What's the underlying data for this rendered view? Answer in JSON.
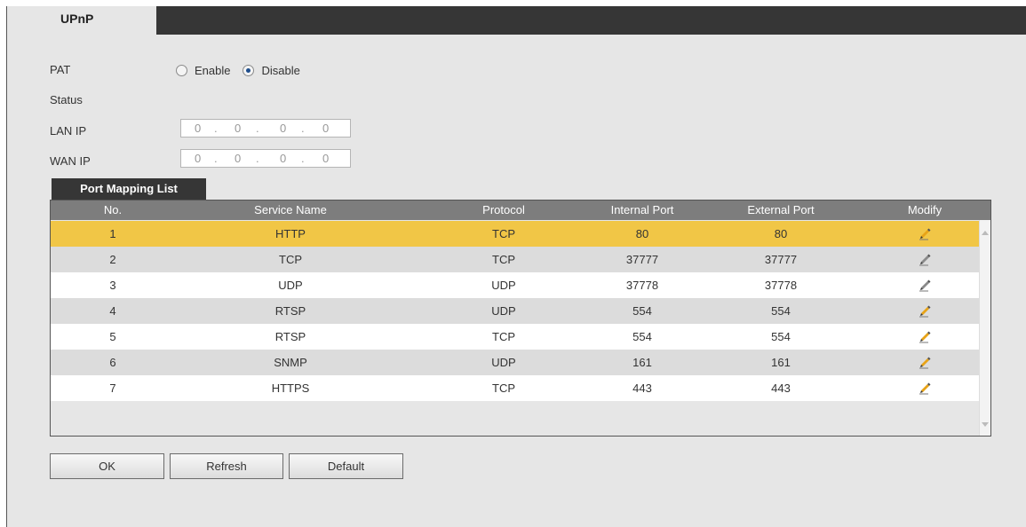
{
  "tab": {
    "label": "UPnP"
  },
  "form": {
    "pat_label": "PAT",
    "enable_label": "Enable",
    "disable_label": "Disable",
    "pat_value": "Disable",
    "status_label": "Status",
    "lan_ip_label": "LAN IP",
    "lan_ip": [
      "0",
      "0",
      "0",
      "0"
    ],
    "wan_ip_label": "WAN IP",
    "wan_ip": [
      "0",
      "0",
      "0",
      "0"
    ]
  },
  "port_mapping": {
    "tab_label": "Port Mapping List",
    "columns": {
      "no": "No.",
      "service_name": "Service Name",
      "protocol": "Protocol",
      "internal_port": "Internal Port",
      "external_port": "External Port",
      "modify": "Modify"
    },
    "rows": [
      {
        "no": "1",
        "service": "HTTP",
        "protocol": "TCP",
        "internal": "80",
        "external": "80",
        "editable": true,
        "selected": true
      },
      {
        "no": "2",
        "service": "TCP",
        "protocol": "TCP",
        "internal": "37777",
        "external": "37777",
        "editable": false
      },
      {
        "no": "3",
        "service": "UDP",
        "protocol": "UDP",
        "internal": "37778",
        "external": "37778",
        "editable": false
      },
      {
        "no": "4",
        "service": "RTSP",
        "protocol": "UDP",
        "internal": "554",
        "external": "554",
        "editable": true
      },
      {
        "no": "5",
        "service": "RTSP",
        "protocol": "TCP",
        "internal": "554",
        "external": "554",
        "editable": true
      },
      {
        "no": "6",
        "service": "SNMP",
        "protocol": "UDP",
        "internal": "161",
        "external": "161",
        "editable": true
      },
      {
        "no": "7",
        "service": "HTTPS",
        "protocol": "TCP",
        "internal": "443",
        "external": "443",
        "editable": true
      }
    ]
  },
  "buttons": {
    "ok": "OK",
    "refresh": "Refresh",
    "default": "Default"
  },
  "colors": {
    "selected_row": "#f1c646",
    "header": "#7d7d7d",
    "tab_bar": "#363636",
    "pencil_active": "#e8a317",
    "pencil_disabled": "#8a8a8a"
  },
  "icons": {
    "edit": "pencil-icon"
  }
}
